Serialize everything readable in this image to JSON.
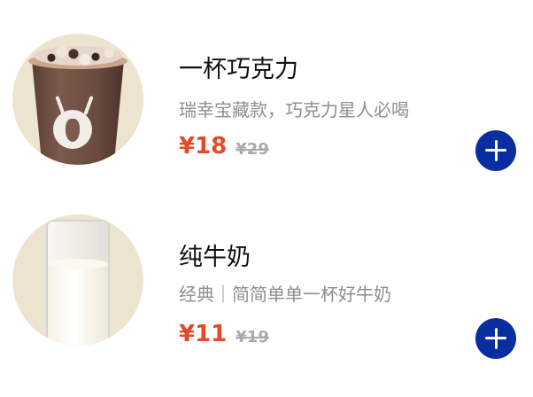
{
  "products": [
    {
      "name": "一杯巧克力",
      "description": "瑞幸宝藏款，巧克力星人必喝",
      "price": "¥18",
      "original_price": "¥29",
      "image": "chocolate-drink-cup"
    },
    {
      "name": "纯牛奶",
      "description": "经典｜简简单单一杯好牛奶",
      "price": "¥11",
      "original_price": "¥19",
      "image": "milk-glass"
    }
  ],
  "colors": {
    "price": "#e24a28",
    "original_price": "#aaaaaa",
    "add_button": "#0a2ea0",
    "thumb_bg": "#ece4cf"
  }
}
